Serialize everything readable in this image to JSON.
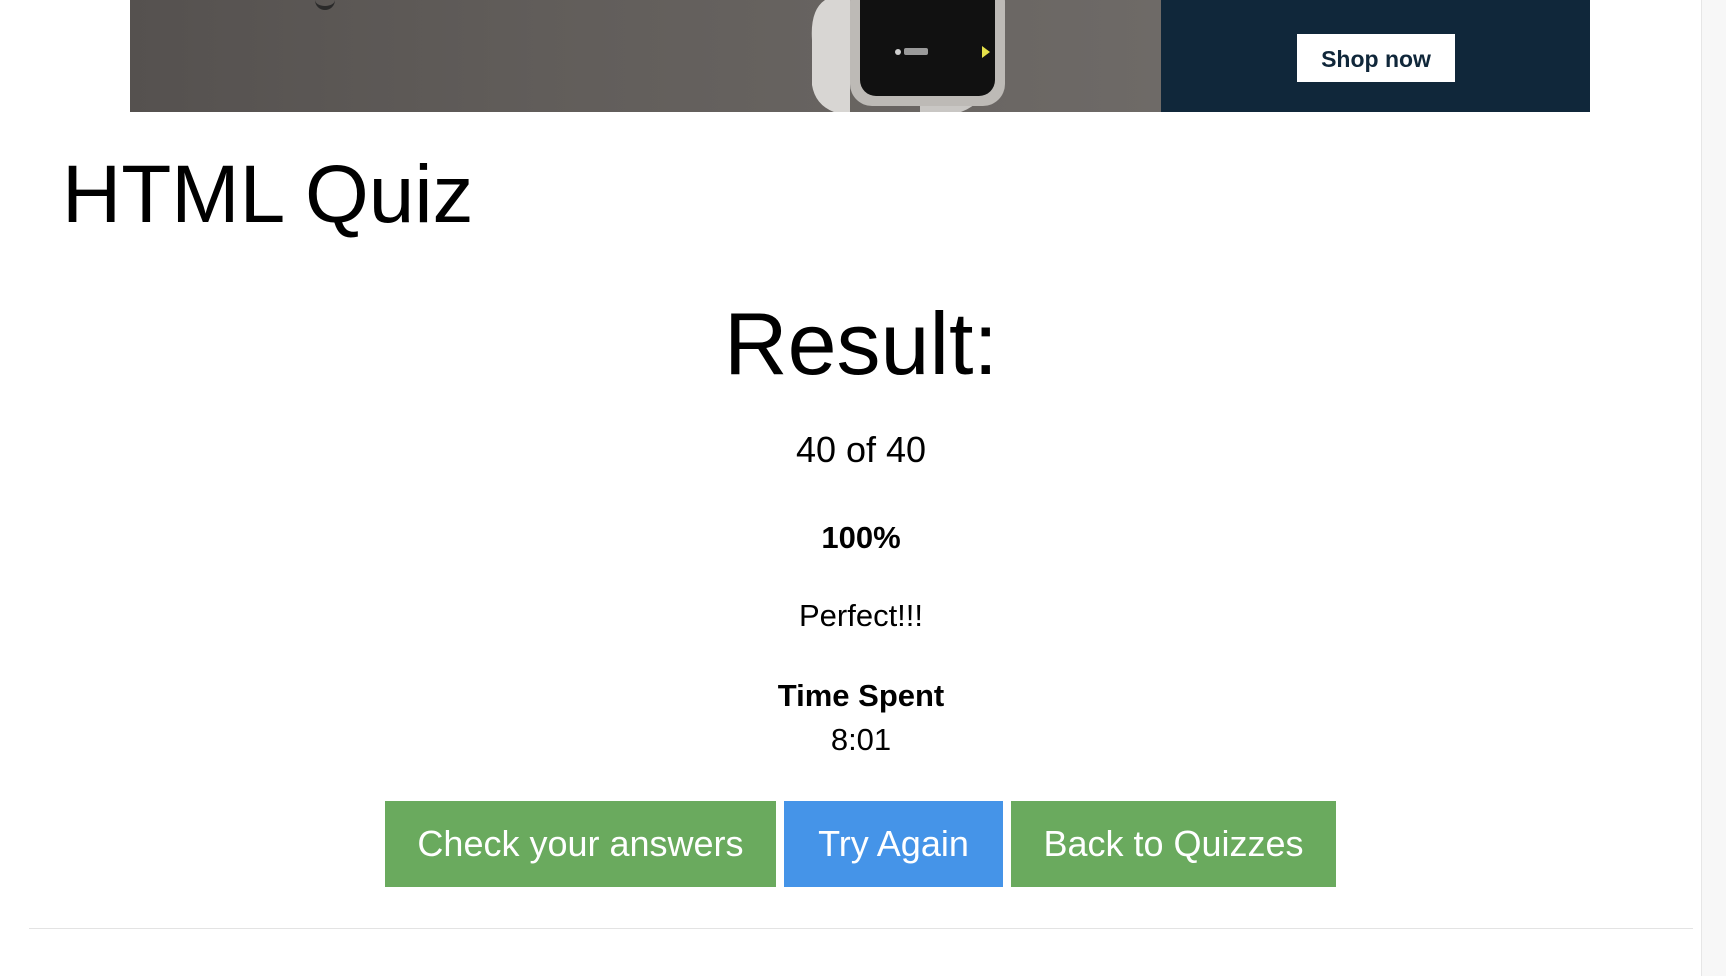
{
  "ad": {
    "shop_label": "Shop now",
    "colors": {
      "banner_grey": "#6b6764",
      "banner_navy": "#10273a"
    }
  },
  "quiz": {
    "title": "HTML Quiz"
  },
  "result": {
    "heading": "Result:",
    "score": "40 of 40",
    "percent": "100%",
    "message": "Perfect!!!",
    "time_label": "Time Spent",
    "time_value": "8:01"
  },
  "actions": {
    "check_label": "Check your answers",
    "try_label": "Try Again",
    "back_label": "Back to Quizzes",
    "colors": {
      "green": "#6aaa5e",
      "blue": "#4594e8"
    }
  }
}
